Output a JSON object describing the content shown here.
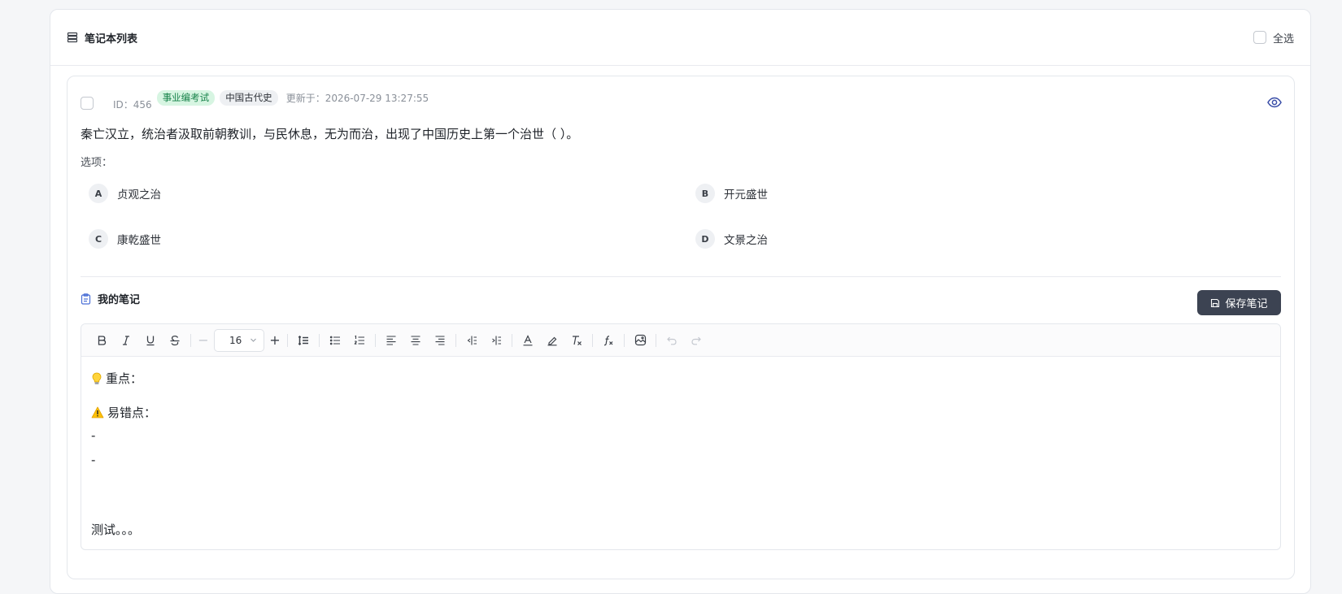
{
  "panel": {
    "title": "笔记本列表",
    "select_all": "全选"
  },
  "card": {
    "id_text": "ID：456",
    "tags": [
      "事业编考试",
      "中国古代史"
    ],
    "updated": "更新于：2026-07-29 13:27:55",
    "question": "秦亡汉立，统治者汲取前朝教训，与民休息，无为而治，出现了中国历史上第一个治世（    ）。",
    "options_label": "选项：",
    "options": [
      {
        "letter": "A",
        "text": "贞观之治"
      },
      {
        "letter": "B",
        "text": "开元盛世"
      },
      {
        "letter": "C",
        "text": "康乾盛世"
      },
      {
        "letter": "D",
        "text": "文景之治"
      }
    ]
  },
  "note": {
    "title": "我的笔记",
    "save_label": "保存笔记",
    "font_size": "16",
    "font_minus": "−",
    "font_plus": "+",
    "content": {
      "key_point": "重点：",
      "error_point": "易错点：",
      "dash1": "-",
      "dash2": "-",
      "test": "测试。。。"
    }
  },
  "colors": {
    "accent": "#3c4352",
    "tag_green_bg": "#d7f5e2",
    "tag_green_text": "#17824a",
    "eye_icon": "#3a4ea8"
  }
}
